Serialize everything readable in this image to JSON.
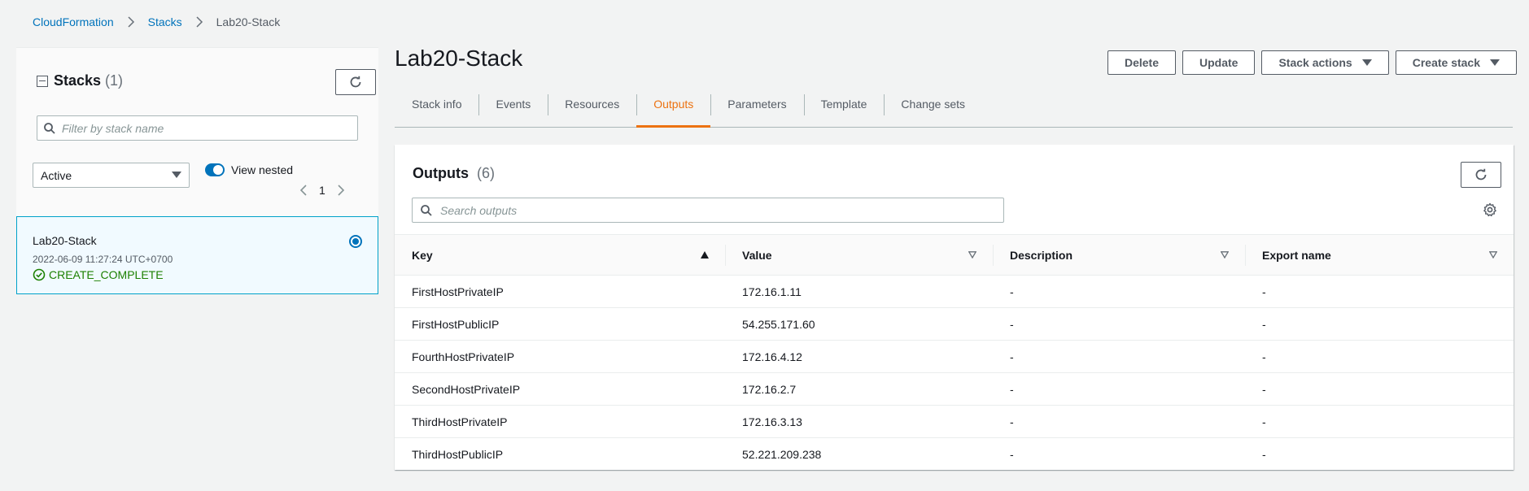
{
  "breadcrumb": {
    "root": "CloudFormation",
    "section": "Stacks",
    "current": "Lab20-Stack"
  },
  "sidebar": {
    "title": "Stacks",
    "count": "(1)",
    "filter_placeholder": "Filter by stack name",
    "status_filter": "Active",
    "view_nested_label": "View nested",
    "page_number": "1",
    "stack": {
      "name": "Lab20-Stack",
      "created": "2022-06-09 11:27:24 UTC+0700",
      "status": "CREATE_COMPLETE"
    }
  },
  "main": {
    "title": "Lab20-Stack",
    "actions": {
      "delete": "Delete",
      "update": "Update",
      "stack_actions": "Stack actions",
      "create_stack": "Create stack"
    },
    "tabs": [
      "Stack info",
      "Events",
      "Resources",
      "Outputs",
      "Parameters",
      "Template",
      "Change sets"
    ],
    "active_tab": "Outputs",
    "outputs": {
      "title": "Outputs",
      "count": "(6)",
      "search_placeholder": "Search outputs",
      "columns": [
        "Key",
        "Value",
        "Description",
        "Export name"
      ],
      "rows": [
        {
          "key": "FirstHostPrivateIP",
          "value": "172.16.1.11",
          "description": "-",
          "export": "-"
        },
        {
          "key": "FirstHostPublicIP",
          "value": "54.255.171.60",
          "description": "-",
          "export": "-"
        },
        {
          "key": "FourthHostPrivateIP",
          "value": "172.16.4.12",
          "description": "-",
          "export": "-"
        },
        {
          "key": "SecondHostPrivateIP",
          "value": "172.16.2.7",
          "description": "-",
          "export": "-"
        },
        {
          "key": "ThirdHostPrivateIP",
          "value": "172.16.3.13",
          "description": "-",
          "export": "-"
        },
        {
          "key": "ThirdHostPublicIP",
          "value": "52.221.209.238",
          "description": "-",
          "export": "-"
        }
      ]
    }
  },
  "colors": {
    "link": "#0073bb",
    "accent": "#ec7211",
    "success": "#1d8102"
  }
}
